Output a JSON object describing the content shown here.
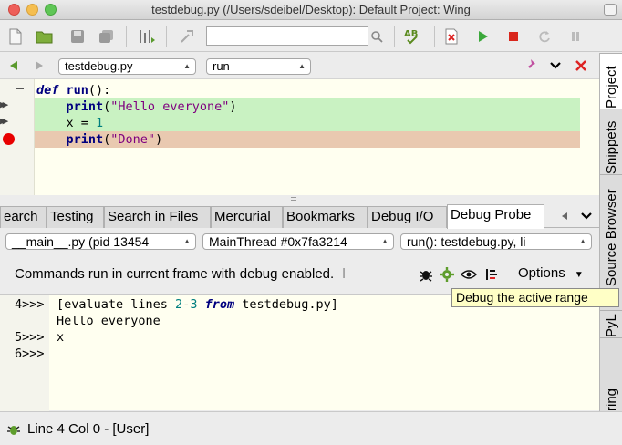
{
  "window": {
    "title": "testdebug.py (/Users/sdeibel/Desktop): Default Project: Wing"
  },
  "toolbar": {
    "search_value": ""
  },
  "editor": {
    "file_dropdown": "testdebug.py",
    "scope_dropdown": "run",
    "lines": {
      "l1_kw": "def",
      "l1_fn": "run",
      "l1_rest": "():",
      "l2_fn": "print",
      "l2_str": "\"Hello everyone\"",
      "l3_a": "x = ",
      "l3_num": "1",
      "l4_fn": "print",
      "l4_str": "\"Done\""
    },
    "highlight_green": "#c9f2c2",
    "highlight_red": "#e9c9b0"
  },
  "tabs": [
    {
      "label": "earch"
    },
    {
      "label": "Testing"
    },
    {
      "label": "Search in Files"
    },
    {
      "label": "Mercurial"
    },
    {
      "label": "Bookmarks"
    },
    {
      "label": "Debug I/O"
    },
    {
      "label": "Debug Probe"
    }
  ],
  "probe": {
    "process_dropdown": "__main__.py (pid 13454",
    "thread_dropdown": "MainThread #0x7fa3214",
    "frame_dropdown": "run(): testdebug.py, li",
    "info_text": "Commands run in current frame with debug enabled.",
    "info_trunc": "l",
    "options_label": "Options",
    "tooltip": "Debug the active range"
  },
  "console": {
    "p4": "4>>>",
    "c4a": "[evaluate lines ",
    "c4n1": "2",
    "c4d": "-",
    "c4n2": "3",
    "c4kw": "from",
    "c4b": " testdebug.py]",
    "out1": "Hello everyone",
    "p5": "5>>>",
    "c5": "x",
    "p6": "6>>>"
  },
  "status": {
    "text": "Line 4 Col 0 - [User]"
  },
  "vtabs": [
    {
      "label": "Project"
    },
    {
      "label": "Snippets"
    },
    {
      "label": "Source Browser"
    },
    {
      "label": "PyL"
    },
    {
      "label": "ring"
    }
  ]
}
